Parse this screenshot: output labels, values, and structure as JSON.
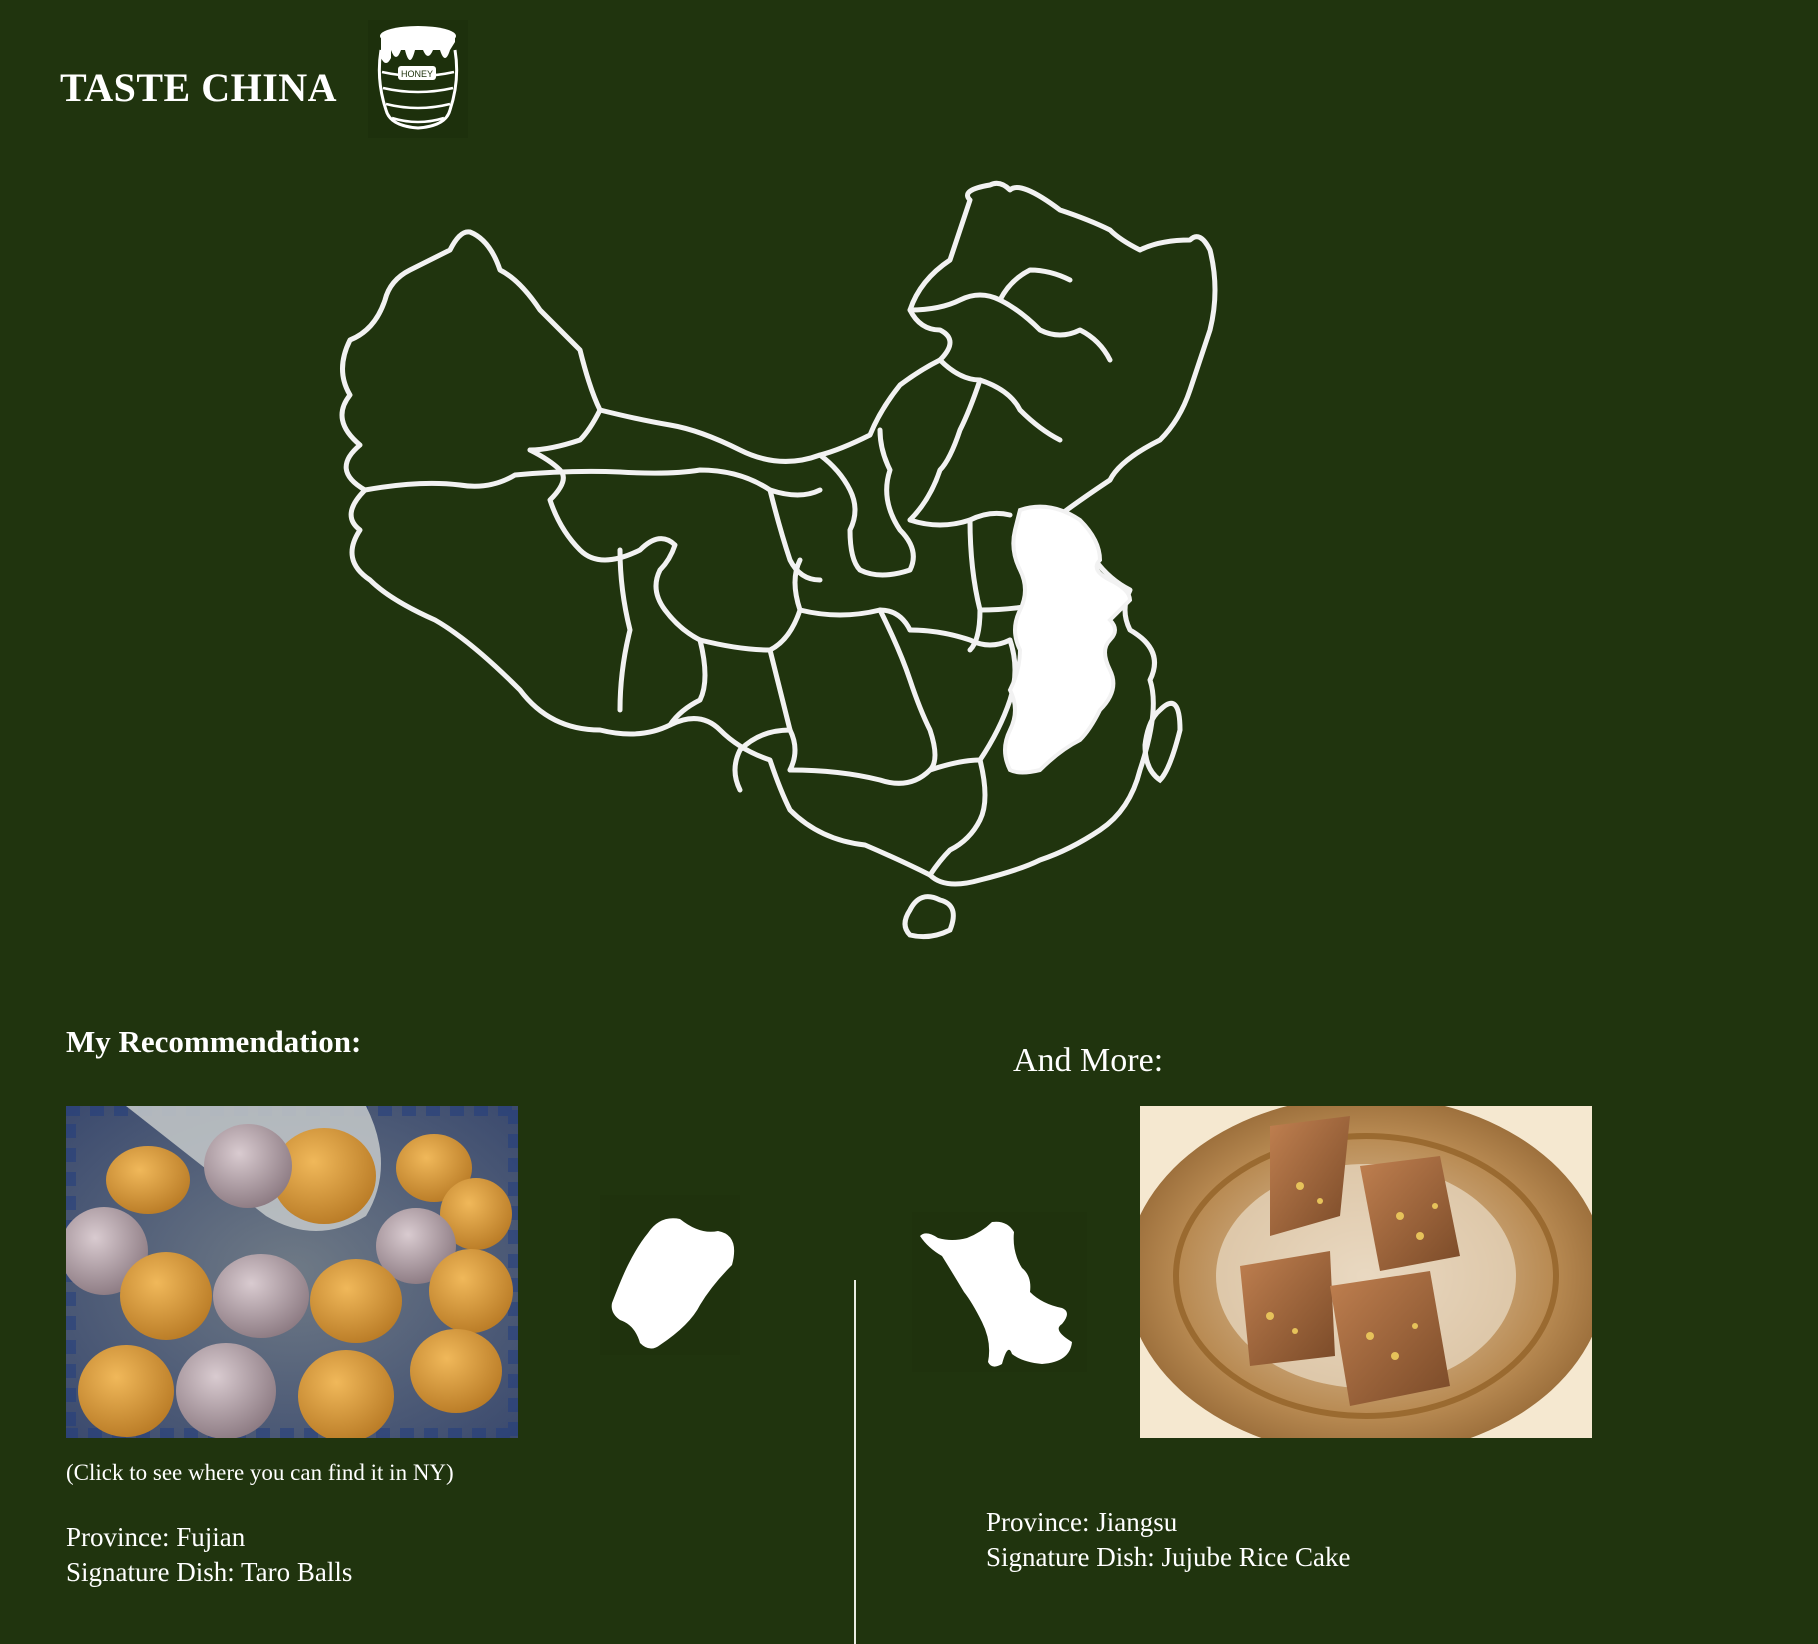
{
  "header": {
    "title": "TASTE CHINA",
    "jar_label": "HONEY"
  },
  "map": {
    "highlight_color": "#ffffff",
    "line_color": "#f2f2f2"
  },
  "recommendation": {
    "heading": "My Recommendation:",
    "click_note": "(Click to see where you can find it in NY)",
    "province_line": "Province: Fujian",
    "dish_line": "Signature Dish: Taro Balls"
  },
  "more": {
    "heading": "And More:",
    "province_line": "Province: Jiangsu",
    "dish_line": "Signature Dish: Jujube Rice Cake"
  },
  "colors": {
    "background": "#20340e",
    "text": "#ffffff"
  }
}
